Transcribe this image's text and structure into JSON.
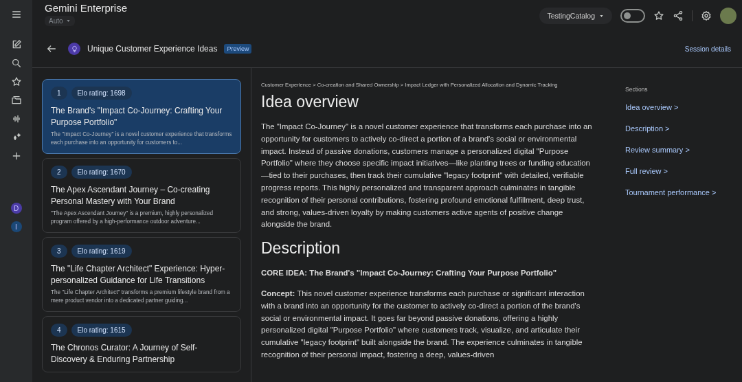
{
  "rail": {
    "avatars": [
      {
        "letter": "D",
        "color": "#4b3ba6"
      },
      {
        "letter": "I",
        "color": "#1b4877"
      }
    ]
  },
  "header": {
    "title": "Gemini Enterprise",
    "model": "Auto",
    "workspace": "TestingCatalog",
    "toggle_on": false
  },
  "session": {
    "title": "Unique Customer Experience Ideas",
    "badge": "Preview",
    "details_link": "Session details"
  },
  "ideas": [
    {
      "rank": "1",
      "elo": "Elo rating: 1698",
      "title": "The Brand's \"Impact Co-Journey: Crafting Your Purpose Portfolio\"",
      "summary": "The \"Impact Co-Journey\" is a novel customer experience that transforms each purchase into an opportunity for customers to...",
      "selected": true
    },
    {
      "rank": "2",
      "elo": "Elo rating: 1670",
      "title": "The Apex Ascendant Journey – Co-creating Personal Mastery with Your Brand",
      "summary": "\"The Apex Ascendant Journey\" is a premium, highly personalized program offered by a high-performance outdoor adventure...",
      "selected": false
    },
    {
      "rank": "3",
      "elo": "Elo rating: 1619",
      "title": "The \"Life Chapter Architect\" Experience: Hyper-personalized Guidance for Life Transitions",
      "summary": "The \"Life Chapter Architect\" transforms a premium lifestyle brand from a mere product vendor into a dedicated partner guiding...",
      "selected": false
    },
    {
      "rank": "4",
      "elo": "Elo rating: 1615",
      "title": "The Chronos Curator: A Journey of Self-Discovery & Enduring Partnership",
      "selected": false
    }
  ],
  "detail": {
    "breadcrumb": "Customer Experience > Co-creation and Shared Ownership > Impact Ledger with Personalized Allocation and Dynamic Tracking",
    "overview_heading": "Idea overview",
    "overview": "The \"Impact Co-Journey\" is a novel customer experience that transforms each purchase into an opportunity for customers to actively co-direct a portion of a brand's social or environmental impact. Instead of passive donations, customers manage a personalized digital \"Purpose Portfolio\" where they choose specific impact initiatives—like planting trees or funding education—tied to their purchases, then track their cumulative \"legacy footprint\" with detailed, verifiable progress reports. This highly personalized and transparent approach culminates in tangible recognition of their personal contributions, fostering profound emotional fulfillment, deep trust, and strong, values-driven loyalty by making customers active agents of positive change alongside the brand.",
    "description_heading": "Description",
    "core_idea": "CORE IDEA: The Brand's \"Impact Co-Journey: Crafting Your Purpose Portfolio\"",
    "concept": "**Concept:** This novel customer experience transforms each purchase or significant interaction with a brand into an opportunity for the customer to actively co-direct a portion of the brand's social or environmental impact. It goes far beyond passive donations, offering a highly personalized digital \"Purpose Portfolio\" where customers track, visualize, and articulate their cumulative \"legacy footprint\" built alongside the brand. The experience culminates in tangible recognition of their personal impact, fostering a deep, values-driven"
  },
  "sections": {
    "label": "Sections",
    "items": [
      "Idea overview >",
      "Description >",
      "Review summary >",
      "Full review >",
      "Tournament performance >"
    ]
  }
}
